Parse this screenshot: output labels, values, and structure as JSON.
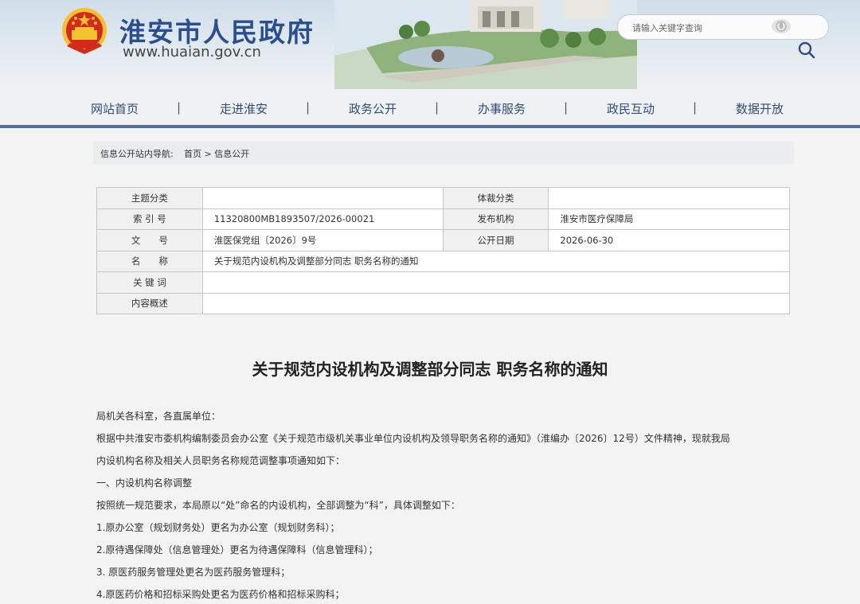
{
  "header": {
    "title": "淮安市人民政府",
    "url": "www.huaian.gov.cn",
    "search_placeholder": "请输入关键字查询"
  },
  "nav": {
    "items": [
      "网站首页",
      "走进淮安",
      "政务公开",
      "办事服务",
      "政民互动",
      "数据开放"
    ],
    "separator": "|"
  },
  "breadcrumb": {
    "label": "信息公开站内导航:",
    "path": "首页 > 信息公开"
  },
  "meta": {
    "topic_label": "主题分类",
    "topic_value": "",
    "genre_label": "体裁分类",
    "genre_value": "",
    "index_label": "索 引 号",
    "index_value": "11320800MB1893507/2026-00021",
    "publisher_label": "发布机构",
    "publisher_value": "淮安市医疗保障局",
    "docno_label": "文　　号",
    "docno_value": "淮医保党组〔2026〕9号",
    "date_label": "公开日期",
    "date_value": "2026-06-30",
    "name_label": "名　　称",
    "name_value": "关于规范内设机构及调整部分同志 职务名称的通知",
    "keywords_label": "关 键 词",
    "keywords_value": "",
    "summary_label": "内容概述",
    "summary_value": ""
  },
  "article": {
    "title": "关于规范内设机构及调整部分同志 职务名称的通知",
    "paragraphs": [
      "局机关各科室，各直属单位：",
      "根据中共淮安市委机构编制委员会办公室《关于规范市级机关事业单位内设机构及领导职务名称的通知》（淮编办〔2026〕12号）文件精神，现就我局",
      "内设机构名称及相关人员职务名称规范调整事项通知如下：",
      "一、内设机构名称调整",
      " 按照统一规范要求，本局原以“处”命名的内设机构，全部调整为“科”，具体调整如下：",
      "1.原办公室（规划财务处）更名为办公室（规划财务科）；",
      "2.原待遇保障处（信息管理处）更名为待遇保障科（信息管理科）；",
      "3. 原医药服务管理处更名为医药服务管理科；",
      "4.原医药价格和招标采购处更名为医药价格和招标采购科；"
    ]
  },
  "colors": {
    "brand_blue": "#2a4f8e",
    "nav_text": "#2f4d7a",
    "nav_underline": "#4f6f9f",
    "emblem_red": "#d42a1e",
    "emblem_gold": "#f2c230"
  }
}
